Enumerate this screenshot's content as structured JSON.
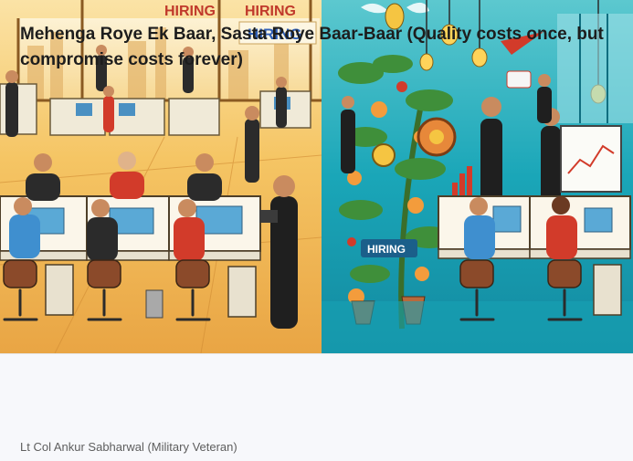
{
  "article": {
    "title": "Mehenga Roye Ek Baar, Sasta Roye Baar-Baar (Quality costs once, but compromise costs forever)",
    "author": "Lt Col Ankur Sabharwal (Military Veteran)"
  },
  "hero_image": {
    "sign_1": "HIRING",
    "sign_2": "HIRING",
    "sign_3": "HIRING",
    "sign_4": "HIRING",
    "colors": {
      "left_panel": "#f3c15a",
      "right_panel": "#1aa6b8",
      "accent_red": "#d23b2a",
      "sign_blue": "#2f5fb8"
    }
  }
}
